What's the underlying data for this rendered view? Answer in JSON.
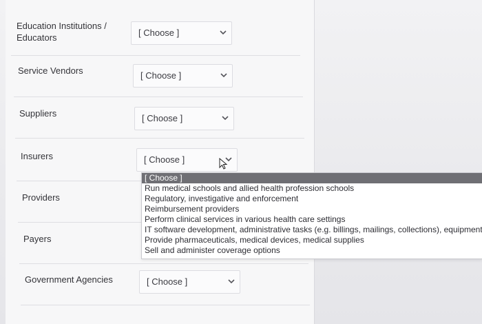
{
  "rows": [
    {
      "label": "Education Institutions /\nEducators",
      "select_value": "[ Choose ]"
    },
    {
      "label": "Service Vendors",
      "select_value": "[ Choose ]"
    },
    {
      "label": "Suppliers",
      "select_value": "[ Choose ]"
    },
    {
      "label": "Insurers",
      "select_value": "[ Choose ]"
    },
    {
      "label": "Providers"
    },
    {
      "label": "Payers"
    },
    {
      "label": "Government Agencies",
      "select_value": "[ Choose ]"
    }
  ],
  "dropdown": {
    "options": [
      "[ Choose ]",
      "Run medical schools and allied health profession schools",
      "Regulatory, investigative and enforcement",
      "Reimbursement providers",
      "Perform clinical services in various health care settings",
      "IT software development, administrative tasks (e.g. billings, mailings, collections), equipment cont",
      "Provide pharmaceuticals, medical devices, medical supplies",
      "Sell and administer coverage options"
    ],
    "selected_index": 0
  },
  "icons": {
    "chevron": "chevron-down-icon",
    "cursor": "mouse-pointer-icon"
  },
  "colors": {
    "highlight": "#6f6f74",
    "page_bg": "#f7f7f8"
  }
}
